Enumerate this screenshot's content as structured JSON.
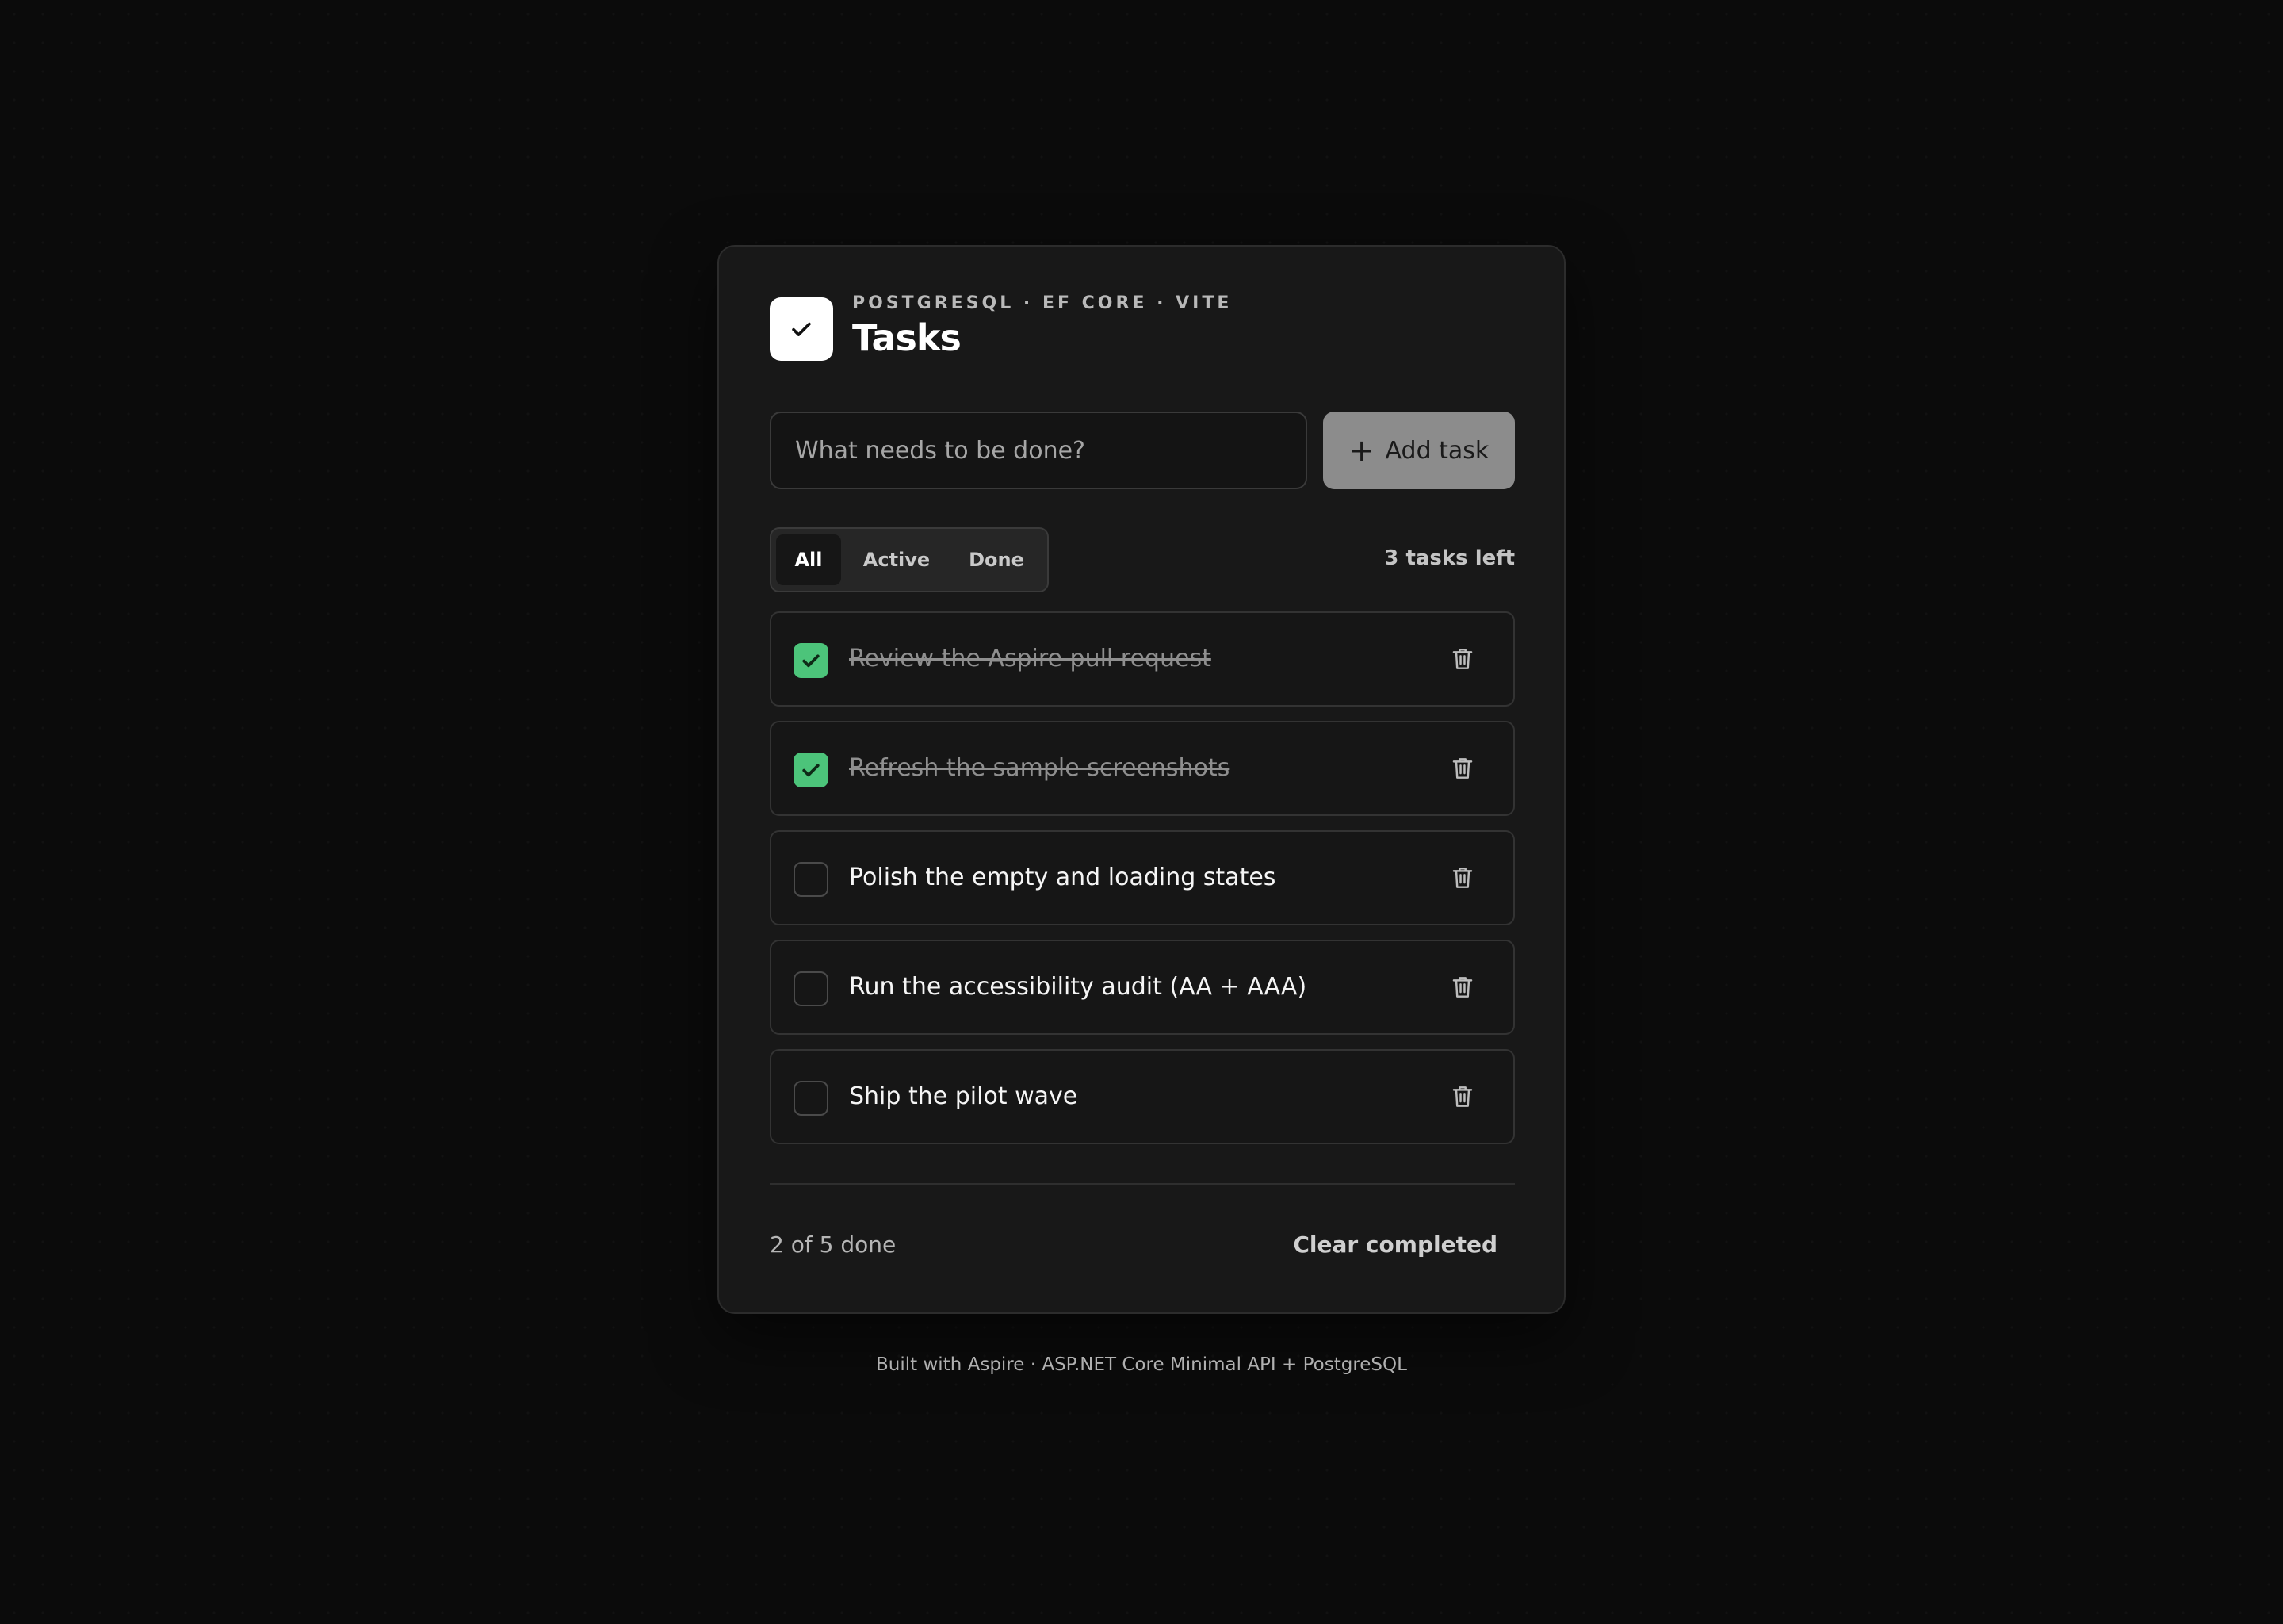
{
  "header": {
    "kicker": "POSTGRESQL · EF CORE · VITE",
    "title": "Tasks",
    "logo_icon": "checkmark-icon"
  },
  "add_form": {
    "placeholder": "What needs to be done?",
    "value": "",
    "button_label": "Add task",
    "button_icon": "plus-icon"
  },
  "filters": {
    "options": [
      "All",
      "Active",
      "Done"
    ],
    "selected": "All"
  },
  "tasks_left_label": "3 tasks left",
  "tasks": [
    {
      "text": "Review the Aspire pull request",
      "done": true
    },
    {
      "text": "Refresh the sample screenshots",
      "done": true
    },
    {
      "text": "Polish the empty and loading states",
      "done": false
    },
    {
      "text": "Run the accessibility audit (AA + AAA)",
      "done": false
    },
    {
      "text": "Ship the pilot wave",
      "done": false
    }
  ],
  "footer": {
    "progress": "2 of 5 done",
    "clear_label": "Clear completed"
  },
  "page_footer": "Built with Aspire · ASP.NET Core Minimal API + PostgreSQL",
  "colors": {
    "background": "#0b0b0b",
    "card": "#181818",
    "accent_done": "#4cc47a",
    "add_button": "#8c8c8c"
  }
}
